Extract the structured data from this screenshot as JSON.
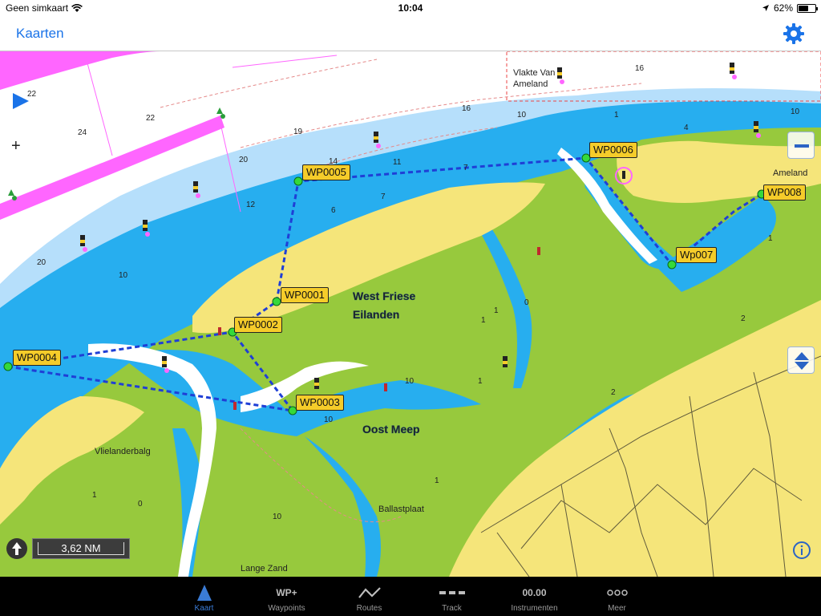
{
  "status_bar": {
    "carrier": "Geen simkaart",
    "time": "10:04",
    "battery": "62%"
  },
  "nav": {
    "back_label": "Kaarten"
  },
  "map": {
    "place_labels": {
      "west_friese": "West Friese",
      "eilanden": "Eilanden",
      "oost_meep": "Oost Meep",
      "vlakte_van": "Vlakte Van",
      "ameland_north": "Ameland",
      "ameland": "Ameland",
      "vlielanderbalg": "Vlielanderbalg",
      "ballastplaat": "Ballastplaat",
      "lange_zand": "Lange Zand"
    },
    "waypoints": [
      {
        "id": "WP0001"
      },
      {
        "id": "WP0002"
      },
      {
        "id": "WP0003"
      },
      {
        "id": "WP0004"
      },
      {
        "id": "WP0005"
      },
      {
        "id": "WP0006"
      },
      {
        "id": "Wp007"
      },
      {
        "id": "WP008"
      }
    ],
    "route_color": "#1f3fd6",
    "depth_soundings": [
      "22",
      "24",
      "22",
      "19",
      "20",
      "14",
      "11",
      "7",
      "12",
      "6",
      "7",
      "16",
      "10",
      "1",
      "4",
      "16",
      "10",
      "20",
      "10",
      "1",
      "0",
      "1",
      "2",
      "10",
      "1",
      "10",
      "1",
      "0",
      "10",
      "2",
      "1",
      "1"
    ],
    "colors": {
      "deep_water": "#ffffff",
      "channel": "#27aeef",
      "shallow": "#b6dffb",
      "drying": "#97c93d",
      "land": "#f5e57a",
      "restricted": "#ff66ff"
    }
  },
  "scale": {
    "label": "3,62 NM"
  },
  "tabs": [
    {
      "label": "Kaart",
      "icon": "map-arrow-icon",
      "active": true
    },
    {
      "label": "Waypoints",
      "icon_text": "WP+"
    },
    {
      "label": "Routes",
      "icon": "route-icon"
    },
    {
      "label": "Track",
      "icon": "track-icon"
    },
    {
      "label": "Instrumenten",
      "icon_text": "00.00"
    },
    {
      "label": "Meer",
      "icon": "more-icon"
    }
  ]
}
